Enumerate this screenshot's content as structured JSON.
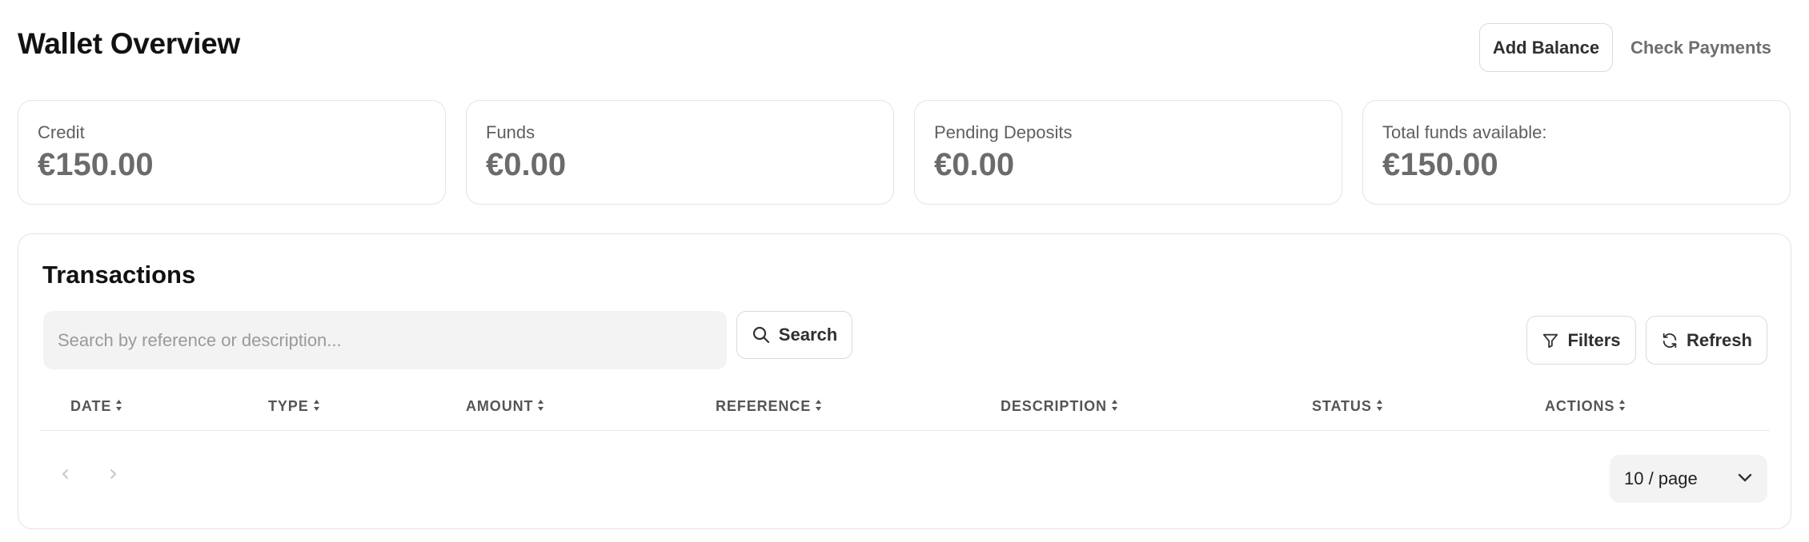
{
  "header": {
    "title": "Wallet Overview",
    "add_balance_label": "Add Balance",
    "check_payments_label": "Check Payments"
  },
  "stats": [
    {
      "label": "Credit",
      "value": "€150.00"
    },
    {
      "label": "Funds",
      "value": "€0.00"
    },
    {
      "label": "Pending Deposits",
      "value": "€0.00"
    },
    {
      "label": "Total funds available:",
      "value": "€150.00"
    }
  ],
  "transactions": {
    "title": "Transactions",
    "search": {
      "placeholder": "Search by reference or description...",
      "value": "",
      "button_label": "Search"
    },
    "filters_label": "Filters",
    "refresh_label": "Refresh",
    "columns": [
      "DATE",
      "TYPE",
      "AMOUNT",
      "REFERENCE",
      "DESCRIPTION",
      "STATUS",
      "ACTIONS"
    ],
    "rows": [],
    "pagination": {
      "page_size_label": "10 / page"
    }
  },
  "icons": {
    "search": "search-icon",
    "filter": "filter-icon",
    "refresh": "refresh-icon",
    "sort": "sort-icon",
    "prev": "chevron-left-icon",
    "next": "chevron-right-icon",
    "dropdown": "chevron-down-icon"
  },
  "colors": {
    "border": "#e4e4e4",
    "input_bg": "#f3f3f3",
    "muted_text": "#6b6b6b"
  }
}
